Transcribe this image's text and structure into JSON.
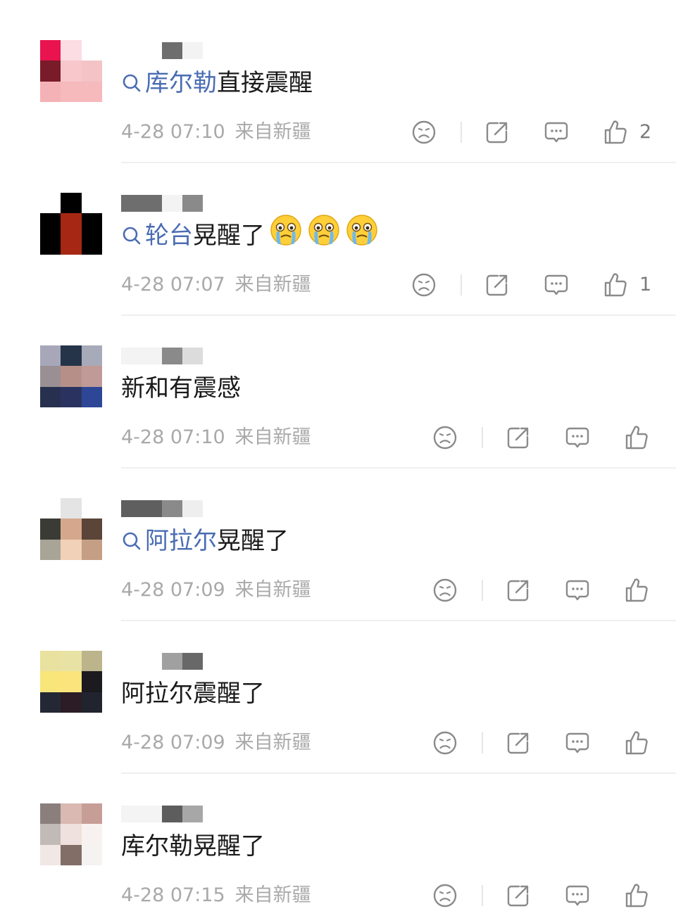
{
  "colors": {
    "topic_link": "#4a6cb3",
    "text": "#1a1a1a",
    "meta": "#a9a9a9",
    "icon": "#8a8a8a",
    "divider": "#efefef"
  },
  "icons": {
    "topic": "magnifier-icon",
    "dislike": "sad-face-icon",
    "share": "share-icon",
    "reply": "comment-bubble-icon",
    "like": "thumbs-up-icon",
    "emoji": "crying-face-emoji"
  },
  "comments": [
    {
      "avatar_colors": [
        "#e8134f",
        "#fbdde3",
        "#ffffff",
        "#7a1b2a",
        "#f7c7cb",
        "#f4c3c6",
        "#f5b2b6",
        "#f6b9bc",
        "#f6b9bc"
      ],
      "name_blocks": [
        "#ffffff",
        "#6e6e6e",
        "#f3f3f3"
      ],
      "topic": "库尔勒",
      "text": "直接震醒",
      "emoji_count": 0,
      "time": "4-28 07:10",
      "source": "来自新疆",
      "like_count": "2"
    },
    {
      "avatar_colors": [
        "#ffffff",
        "#000000",
        "#ffffff",
        "#000000",
        "#a52714",
        "#000000",
        "#000000",
        "#a52714",
        "#000000"
      ],
      "name_blocks": [
        "#6e6e6e",
        "#f3f3f3",
        "#8a8a8a"
      ],
      "topic": "轮台",
      "text": "晃醒了",
      "emoji_count": 3,
      "time": "4-28 07:07",
      "source": "来自新疆",
      "like_count": "1"
    },
    {
      "avatar_colors": [
        "#a7a7b9",
        "#253449",
        "#a7aab8",
        "#9a8f93",
        "#b69088",
        "#c09a97",
        "#27304e",
        "#2a3360",
        "#2d4796"
      ],
      "name_blocks": [
        "#f3f3f3",
        "#8a8a8a",
        "#dcdcdc"
      ],
      "topic": "",
      "text": "新和有震感",
      "emoji_count": 0,
      "time": "4-28 07:10",
      "source": "来自新疆",
      "like_count": ""
    },
    {
      "avatar_colors": [
        "#ffffff",
        "#e4e4e4",
        "#ffffff",
        "#3b3b36",
        "#d5a88d",
        "#5a4538",
        "#a8a597",
        "#f1d1b8",
        "#c59f85"
      ],
      "name_blocks": [
        "#5f5f5f",
        "#8a8a8a",
        "#eeeeee"
      ],
      "topic": "阿拉尔",
      "text": "晃醒了",
      "emoji_count": 0,
      "time": "4-28 07:09",
      "source": "来自新疆",
      "like_count": ""
    },
    {
      "avatar_colors": [
        "#e9e19f",
        "#e8e3a4",
        "#bcb48a",
        "#f8e67b",
        "#fae47b",
        "#1a1a1f",
        "#232834",
        "#2b1c26",
        "#21232e"
      ],
      "name_blocks": [
        "#ffffff",
        "#a0a0a0",
        "#686868"
      ],
      "topic": "",
      "text": "阿拉尔震醒了",
      "emoji_count": 0,
      "time": "4-28 07:09",
      "source": "来自新疆",
      "like_count": ""
    },
    {
      "avatar_colors": [
        "#8b7f7d",
        "#d9b9b2",
        "#c69e96",
        "#c1bab7",
        "#efe1dd",
        "#f7f2f0",
        "#f1e8e5",
        "#836e67",
        "#f4f3f2"
      ],
      "name_blocks": [
        "#f4f4f4",
        "#5d5d5d",
        "#a7a7a7"
      ],
      "topic": "",
      "text": "库尔勒晃醒了",
      "emoji_count": 0,
      "time": "4-28 07:15",
      "source": "来自新疆",
      "like_count": ""
    }
  ]
}
